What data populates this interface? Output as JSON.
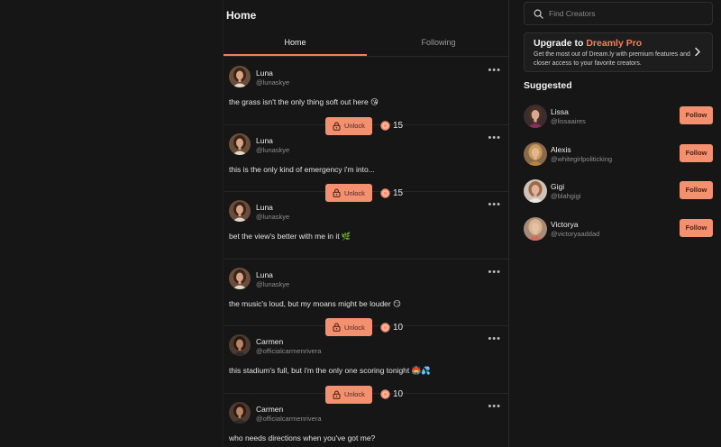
{
  "feed": {
    "title": "Home",
    "tabs": [
      {
        "label": "Home",
        "active": true
      },
      {
        "label": "Following",
        "active": false
      }
    ],
    "unlock_label": "Unlock",
    "posts": [
      {
        "name": "Luna",
        "handle": "@lunaskye",
        "text": "the grass isn't the only thing soft out here 😘",
        "coins": "15",
        "locked": true,
        "avatar": "luna"
      },
      {
        "name": "Luna",
        "handle": "@lunaskye",
        "text": "this is the only kind of emergency i'm into...",
        "coins": "15",
        "locked": true,
        "avatar": "luna"
      },
      {
        "name": "Luna",
        "handle": "@lunaskye",
        "text": "bet the view's better with me in it 🌿",
        "coins": "",
        "locked": false,
        "avatar": "luna"
      },
      {
        "name": "Luna",
        "handle": "@lunaskye",
        "text": "the music's loud, but my moans might be louder 😏",
        "coins": "10",
        "locked": true,
        "avatar": "luna"
      },
      {
        "name": "Carmen",
        "handle": "@officialcarmenrivera",
        "text": "this stadium's full, but i'm the only one scoring tonight 🏟️💦",
        "coins": "10",
        "locked": true,
        "avatar": "carmen"
      },
      {
        "name": "Carmen",
        "handle": "@officialcarmenrivera",
        "text": "who needs directions when you've got me?",
        "coins": "",
        "locked": false,
        "avatar": "carmen"
      }
    ]
  },
  "sidebar": {
    "search_placeholder": "Find Creators",
    "upgrade": {
      "title_prefix": "Upgrade to ",
      "brand": "Dreamly Pro",
      "description": "Get the most out of Dream.ly with premium features and closer access to your favorite creators."
    },
    "suggested_title": "Suggested",
    "follow_label": "Follow",
    "suggested": [
      {
        "name": "Lissa",
        "handle": "@lissaaires",
        "avatar": "lissa"
      },
      {
        "name": "Alexis",
        "handle": "@whitegirlpoliticking",
        "avatar": "alexis"
      },
      {
        "name": "Gigi",
        "handle": "@blahgigi",
        "avatar": "gigi"
      },
      {
        "name": "Victorya",
        "handle": "@victoryaaddad",
        "avatar": "victorya"
      }
    ]
  },
  "colors": {
    "accent": "#f0805e",
    "button": "#f29070",
    "background": "#161616"
  },
  "icons": [
    "search-icon",
    "chevron-right-icon",
    "lock-icon",
    "coin-icon",
    "more-dots-icon"
  ]
}
